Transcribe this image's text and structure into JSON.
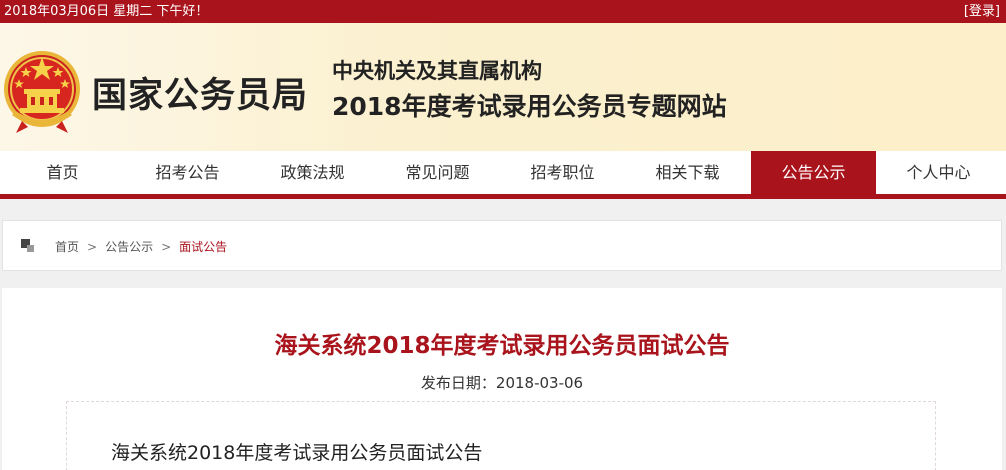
{
  "topbar": {
    "date_text": "2018年03月06日  星期二  下午好！",
    "login_label": "[登录]"
  },
  "header": {
    "agency_name": "国家公务员局",
    "subtitle_line1": "中央机关及其直属机构",
    "subtitle_line2": "2018年度考试录用公务员专题网站",
    "emblem_icon": "national-emblem-icon"
  },
  "nav": {
    "items": [
      {
        "label": "首页"
      },
      {
        "label": "招考公告"
      },
      {
        "label": "政策法规"
      },
      {
        "label": "常见问题"
      },
      {
        "label": "招考职位"
      },
      {
        "label": "相关下载"
      },
      {
        "label": "公告公示"
      },
      {
        "label": "个人中心"
      }
    ],
    "active_index": 6
  },
  "breadcrumb": {
    "items": [
      "首页",
      "公告公示",
      "面试公告"
    ],
    "separator": ">"
  },
  "article": {
    "title": "海关系统2018年度考试录用公务员面试公告",
    "publish_date": "发布日期：2018-03-06",
    "body_title": "海关系统2018年度考试录用公务员面试公告"
  },
  "colors": {
    "brand_red": "#a9141c",
    "header_bg": "#fcefc9"
  }
}
